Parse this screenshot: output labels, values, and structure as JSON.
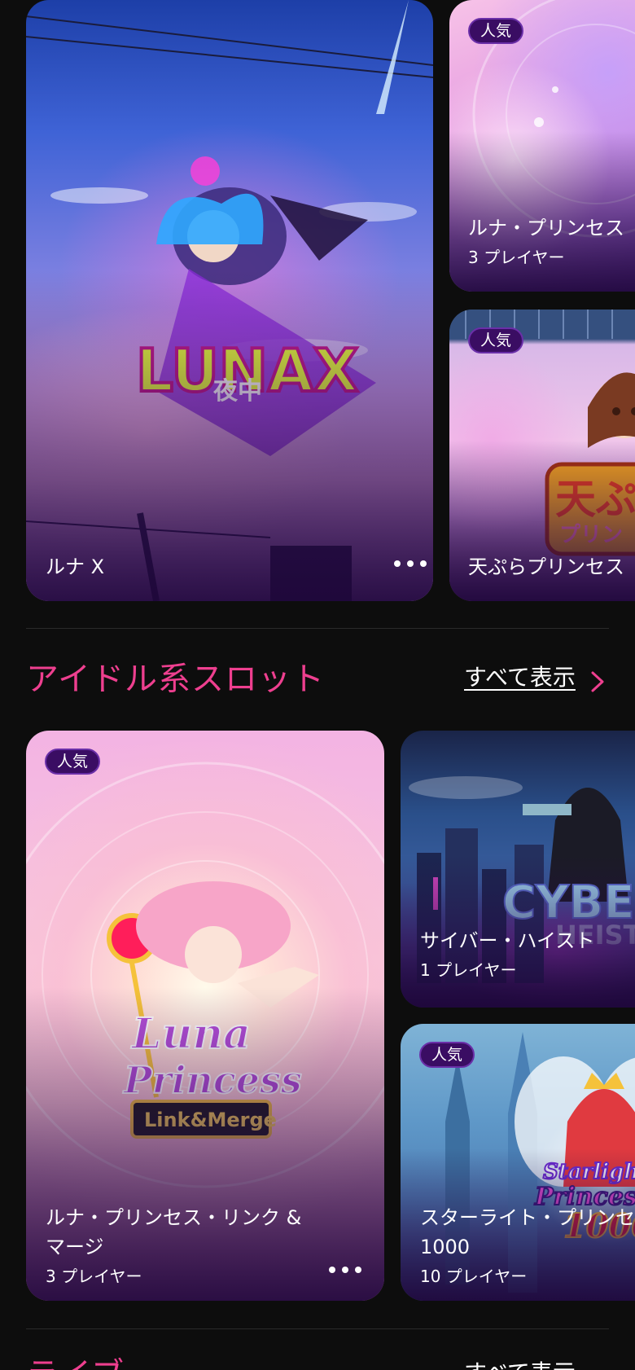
{
  "section1": {
    "cards": [
      {
        "title": "ルナ X",
        "badge": "",
        "players": ""
      },
      {
        "title": "ルナ・プリンセス",
        "badge": "人気",
        "players": "3 プレイヤー"
      },
      {
        "title": "天ぷらプリンセス",
        "badge": "人気",
        "players": ""
      }
    ]
  },
  "section2": {
    "title": "アイドル系スロット",
    "see_all": "すべて表示",
    "cards": [
      {
        "title_line1": "ルナ・プリンセス・リンク &",
        "title_line2": "マージ",
        "badge": "人気",
        "players": "3 プレイヤー"
      },
      {
        "title": "サイバー・ハイスト",
        "badge": "",
        "players": "1 プレイヤー"
      },
      {
        "title_line1": "スターライト・プリンセス",
        "title_line2": "1000",
        "badge": "人気",
        "players": "10 プレイヤー"
      }
    ]
  },
  "section3": {
    "title": "ライブ",
    "see_all": "すべて表示"
  },
  "colors": {
    "accent_pink": "#ee3f8f",
    "badge_bg": "#3a0d63",
    "page_bg": "#0d0d0d"
  }
}
